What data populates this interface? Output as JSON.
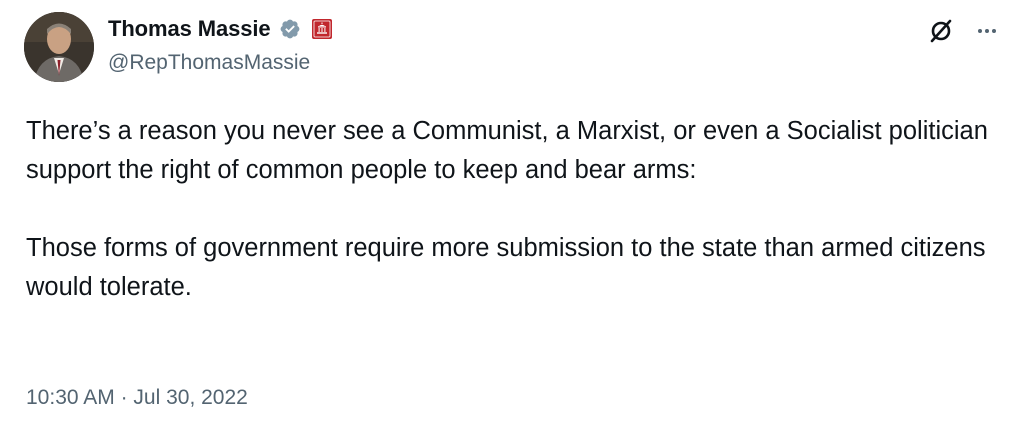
{
  "author": {
    "display_name": "Thomas Massie",
    "handle": "@RepThomasMassie",
    "verified": true,
    "avatar_icon": "profile-photo",
    "affiliation_icon": "congress-badge-icon"
  },
  "tweet": {
    "paragraphs": [
      "There’s a reason you never see a Communist, a Marxist, or even a Socialist politician support the right of common people to keep and bear arms:",
      "Those forms of government require more submission to the state than armed citizens would tolerate."
    ]
  },
  "meta": {
    "time": "10:30 AM",
    "separator": "·",
    "date": "Jul 30, 2022"
  },
  "colors": {
    "text_primary": "#0f1419",
    "text_secondary": "#536471",
    "verified_blue": "#829aab",
    "badge_red": "#c1272d"
  }
}
